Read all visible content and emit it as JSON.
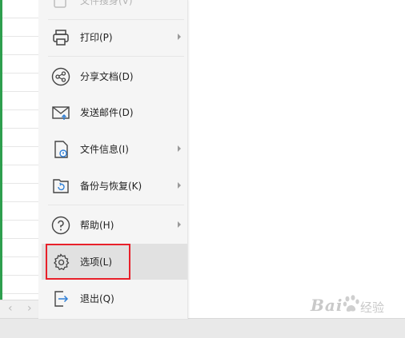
{
  "menu": {
    "items": [
      {
        "label": "文件搜身(V)",
        "icon": "file-search-icon"
      },
      {
        "label": "打印(P)",
        "icon": "printer-icon"
      },
      {
        "label": "分享文档(D)",
        "icon": "share-icon"
      },
      {
        "label": "发送邮件(D)",
        "icon": "mail-icon"
      },
      {
        "label": "文件信息(I)",
        "icon": "file-info-icon"
      },
      {
        "label": "备份与恢复(K)",
        "icon": "backup-restore-icon"
      },
      {
        "label": "帮助(H)",
        "icon": "help-icon"
      },
      {
        "label": "选项(L)",
        "icon": "gear-icon"
      },
      {
        "label": "退出(Q)",
        "icon": "exit-icon"
      }
    ]
  },
  "watermark": {
    "text": "Bai",
    "sub": "经验"
  },
  "colors": {
    "highlight": "#e8202a",
    "sheet_accent": "#2e9f4e"
  }
}
